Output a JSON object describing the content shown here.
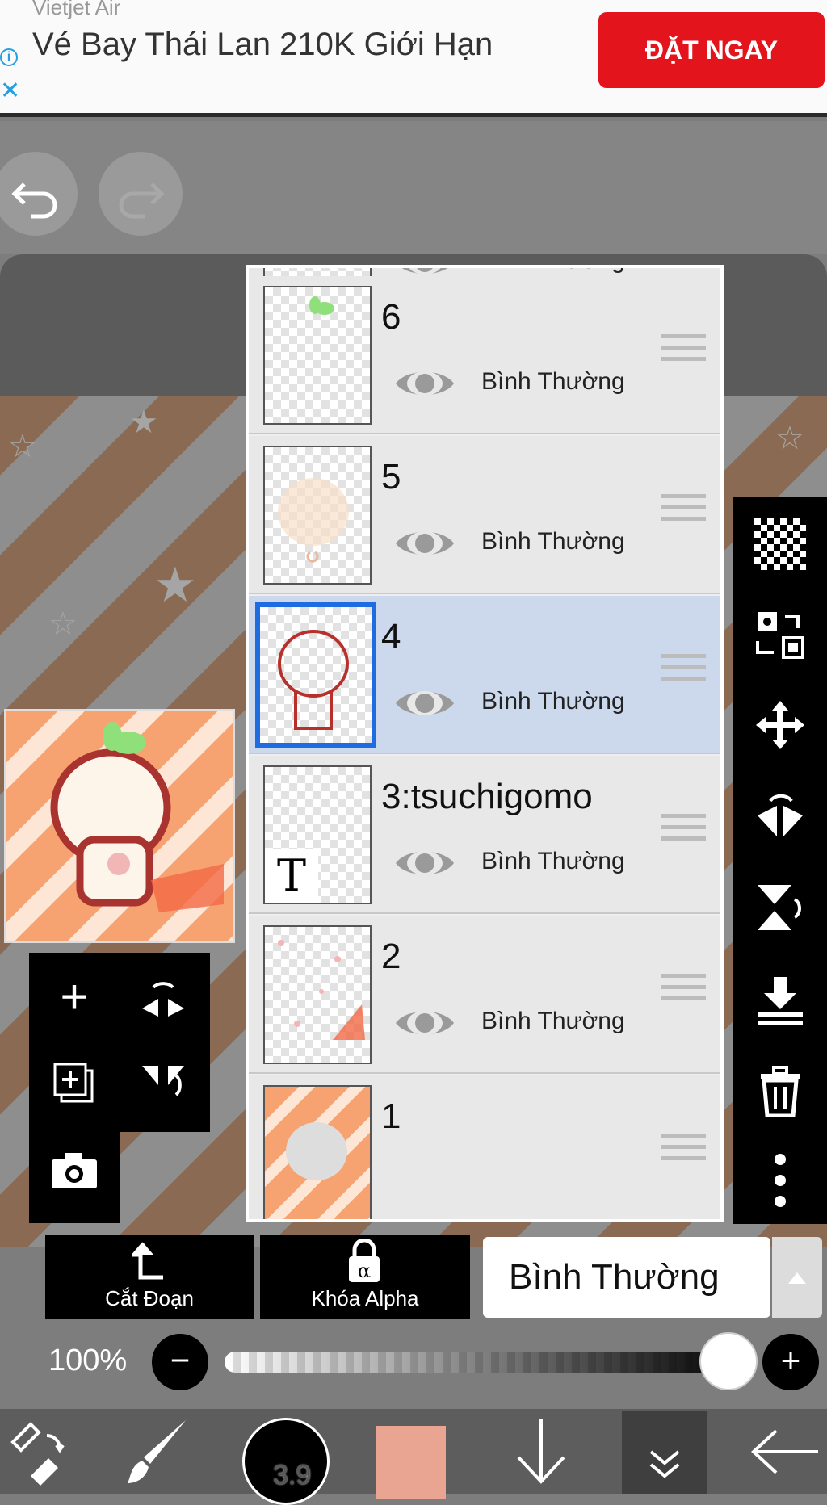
{
  "ad": {
    "advertiser": "Vietjet Air",
    "title": "Vé Bay Thái Lan 210K Giới Hạn",
    "cta": "ĐẶT NGAY",
    "info_icon": "info-icon",
    "close_icon": "close-icon"
  },
  "layers": [
    {
      "name": "",
      "mode": "Bình Thường",
      "selected": false
    },
    {
      "name": "6",
      "mode": "Bình Thường",
      "selected": false
    },
    {
      "name": "5",
      "mode": "Bình Thường",
      "selected": false
    },
    {
      "name": "4",
      "mode": "Bình Thường",
      "selected": true
    },
    {
      "name": "3:tsuchigomo",
      "mode": "Bình Thường",
      "selected": false
    },
    {
      "name": "2",
      "mode": "Bình Thường",
      "selected": false
    },
    {
      "name": "1",
      "mode": "",
      "selected": false
    }
  ],
  "layer_actions": {
    "clipping_label": "Cắt Đoạn",
    "alpha_lock_label": "Khóa Alpha",
    "blend_mode": "Bình Thường"
  },
  "opacity": {
    "label": "100%",
    "value": 100
  },
  "brush": {
    "size": "3.9",
    "color": "#e9a592"
  },
  "colors": {
    "selection": "#1f6be0",
    "ad_button": "#e3141b"
  }
}
